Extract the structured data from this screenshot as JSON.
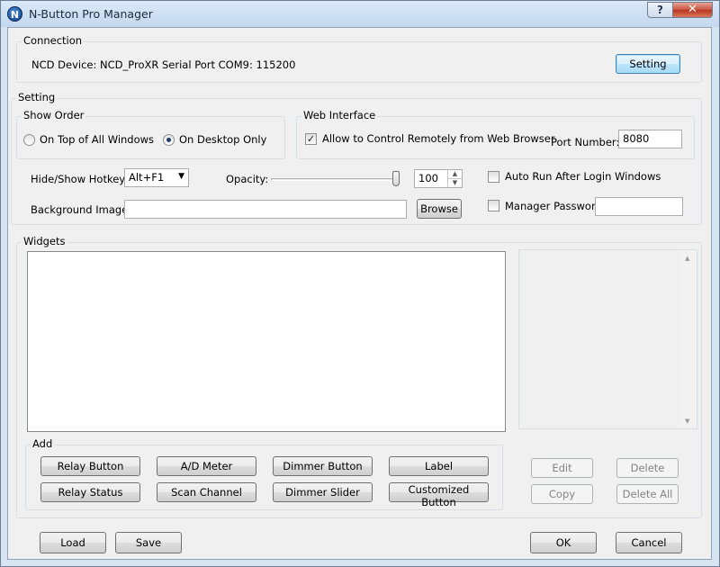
{
  "window": {
    "title": "N-Button Pro Manager",
    "icon_letter": "N",
    "help_glyph": "?",
    "close_glyph": "✕"
  },
  "connection": {
    "label": "Connection",
    "device_info": "NCD Device: NCD_ProXR  Serial Port  COM9: 115200",
    "setting_button": "Setting"
  },
  "setting": {
    "label": "Setting",
    "show_order": {
      "label": "Show Order",
      "option_top": "On Top of All Windows",
      "option_desktop": "On Desktop Only",
      "selected": "On Desktop Only"
    },
    "web_interface": {
      "label": "Web Interface",
      "allow_remote": "Allow to Control Remotely from Web Browser",
      "allow_remote_checked": true,
      "port_label": "Port Number:",
      "port_value": "8080"
    },
    "hotkey_label": "Hide/Show Hotkey:",
    "hotkey_value": "Alt+F1",
    "opacity_label": "Opacity:",
    "opacity_value": "100",
    "auto_run": "Auto Run After Login Windows",
    "bg_image_label": "Background Image:",
    "bg_image_value": "",
    "browse_button": "Browse",
    "manager_password": "Manager Password",
    "password_value": ""
  },
  "widgets": {
    "label": "Widgets",
    "add": {
      "label": "Add",
      "buttons_row1": [
        "Relay Button",
        "A/D Meter",
        "Dimmer Button",
        "Label"
      ],
      "buttons_row2": [
        "Relay Status",
        "Scan Channel",
        "Dimmer Slider",
        "Customized Button"
      ]
    },
    "edit_button": "Edit",
    "delete_button": "Delete",
    "copy_button": "Copy",
    "delete_all_button": "Delete All"
  },
  "footer": {
    "load_button": "Load",
    "save_button": "Save",
    "ok_button": "OK",
    "cancel_button": "Cancel"
  },
  "icons": {
    "app": "n-logo-icon",
    "help": "help-icon",
    "close": "close-icon",
    "dropdown": "chevron-down-icon",
    "spin_up": "spin-up-icon",
    "spin_down": "spin-down-icon",
    "scroll_up": "scroll-up-icon",
    "scroll_down": "scroll-down-icon"
  }
}
